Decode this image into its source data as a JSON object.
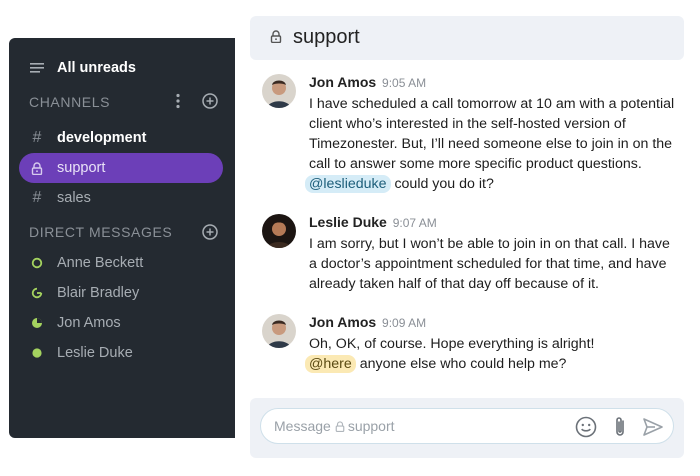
{
  "sidebar": {
    "all_unreads": "All unreads",
    "channels_header": "CHANNELS",
    "channels": [
      {
        "label": "development",
        "icon": "hash-icon"
      },
      {
        "label": "support",
        "icon": "lock-icon"
      },
      {
        "label": "sales",
        "icon": "hash-icon"
      }
    ],
    "dm_header": "DIRECT MESSAGES",
    "dms": [
      {
        "label": "Anne Beckett",
        "status": "ring"
      },
      {
        "label": "Blair Bradley",
        "status": "partial"
      },
      {
        "label": "Jon Amos",
        "status": "pie"
      },
      {
        "label": "Leslie Duke",
        "status": "online"
      }
    ]
  },
  "header": {
    "channel": "support"
  },
  "messages": [
    {
      "author": "Jon Amos",
      "time": "9:05 AM",
      "text": "I have scheduled a call tomorrow at 10 am with a potential client who’s interested in the self-hosted version of Timezonester. But, I’ll need someone else to join in on the call to answer some more specific product questions.",
      "mention": "@leslieduke",
      "after": "could you do it?"
    },
    {
      "author": "Leslie Duke",
      "time": "9:07 AM",
      "text": "I am sorry, but I won’t be able to join in on that call. I have a doctor’s appointment scheduled for that time, and have already taken half of that day off because of it."
    },
    {
      "author": "Jon Amos",
      "time": "9:09 AM",
      "text": "Oh, OK, of course. Hope everything is alright!",
      "mention": "@here",
      "after": "anyone else who could help me?"
    }
  ],
  "composer": {
    "placeholder_prefix": "Message",
    "placeholder_channel": "support"
  },
  "colors": {
    "sidebar_bg": "#242a31",
    "active_channel": "#6c3fb8",
    "status_green": "#a4d35f"
  }
}
